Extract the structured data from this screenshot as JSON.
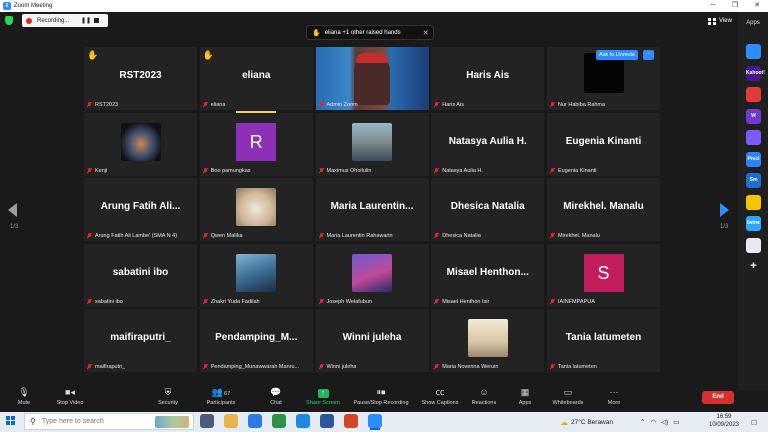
{
  "window": {
    "title": "Zoom Meeting"
  },
  "recording": {
    "label": "Recording...",
    "pause_glyph": "❚❚"
  },
  "raised_hands": {
    "text": "eliana +1 other raised hands"
  },
  "view_label": "View",
  "apps_label": "Apps",
  "unmute_label": "Ask to Unmute",
  "more_label": "···",
  "pagination": {
    "left": "1/3",
    "right": "1/3"
  },
  "tiles": [
    {
      "display": "RST2023",
      "label": "RST2023",
      "hand": true
    },
    {
      "display": "eliana",
      "label": "eliana",
      "hand": true
    },
    {
      "display": "",
      "label": "Admin Zoom",
      "video": true
    },
    {
      "display": "Haris Ais",
      "label": "Haris Ais"
    },
    {
      "display": "",
      "label": "Nur Habiba Rahma",
      "photo": "black"
    },
    {
      "display": "",
      "label": "Kenji",
      "photo": "window"
    },
    {
      "display": "",
      "label": "Boo pamungkas",
      "letter": "R",
      "letter_color": "#8e2fb8"
    },
    {
      "display": "",
      "label": "Maximus Ohoilulin",
      "photo": "person"
    },
    {
      "display": "Natasya Aulia H.",
      "label": "Natasya Aulia H."
    },
    {
      "display": "Eugenia Kinanti",
      "label": "Eugenia Kinanti"
    },
    {
      "display": "Arung  Fatih  Ali...",
      "label": "Arung Fatih Ali Lambe' (SMA N 4)"
    },
    {
      "display": "",
      "label": "Qwen Malika",
      "photo": "cat"
    },
    {
      "display": "Maria  Laurentin...",
      "label": "Maria Laurentin Rahawarin"
    },
    {
      "display": "Dhesica Natalia",
      "label": "Dhesica Natalia"
    },
    {
      "display": "Mirekhel. Manalu",
      "label": "Mirekhel. Manalu"
    },
    {
      "display": "sabatini ibo",
      "label": "sabatini ibo"
    },
    {
      "display": "",
      "label": "Zhakri Yuda Fadilah",
      "photo": "anime"
    },
    {
      "display": "",
      "label": "Joseph Welafubun",
      "photo": "anime2"
    },
    {
      "display": "Misael  Henthon...",
      "label": "Misael Henthon Isir"
    },
    {
      "display": "",
      "label": "IAINFMPAPUA",
      "letter": "S",
      "letter_color": "#c21d5c"
    },
    {
      "display": "maifiraputri_",
      "label": "maifiraputri_"
    },
    {
      "display": "Pendamping_M...",
      "label": "Pendamping_Munawwarah Manru..."
    },
    {
      "display": "Winni juleha",
      "label": "Winni juleha"
    },
    {
      "display": "",
      "label": "Maria Novenna Weruin",
      "photo": "sketch"
    },
    {
      "display": "Tania latumeten",
      "label": "Tania latumeten"
    }
  ],
  "toolbar": {
    "mute": "Mute",
    "stop_video": "Stop Video",
    "security": "Security",
    "participants": "Participants",
    "participants_count": "67",
    "chat": "Chat",
    "share_screen": "Share Screen",
    "record": "Pause/Stop Recording",
    "captions": "Show Captions",
    "reactions": "Reactions",
    "apps": "Apps",
    "whiteboards": "Whiteboards",
    "more": "More",
    "end": "End"
  },
  "apps_sidebar": [
    {
      "name": "zoom-app",
      "text": "",
      "color": "#2d8cff"
    },
    {
      "name": "kahoot-app",
      "text": "Kahoot!",
      "color": "#46178f"
    },
    {
      "name": "app-3",
      "text": "",
      "color": "#e03a3a"
    },
    {
      "name": "wordwall-app",
      "text": "W",
      "color": "#6c3bd1"
    },
    {
      "name": "app-5",
      "text": "",
      "color": "#7a5af8"
    },
    {
      "name": "prezi-app",
      "text": "Prezi",
      "color": "#3181ff"
    },
    {
      "name": "smartsheet-app",
      "text": "Sm",
      "color": "#1f6fd1"
    },
    {
      "name": "app-8",
      "text": "",
      "color": "#f5c400"
    },
    {
      "name": "twine-app",
      "text": "twine",
      "color": "#2ca7ff"
    },
    {
      "name": "app-10",
      "text": "",
      "color": "#e8eaed"
    }
  ],
  "taskbar": {
    "search_placeholder": "Type here to search",
    "weather": "27°C  Berawan",
    "time": "16:59",
    "date": "10/09/2023"
  },
  "colors": {
    "accent": "#2d8cff",
    "end": "#d63031",
    "share": "#22b35e",
    "active_speaker": "#f0d84c"
  }
}
